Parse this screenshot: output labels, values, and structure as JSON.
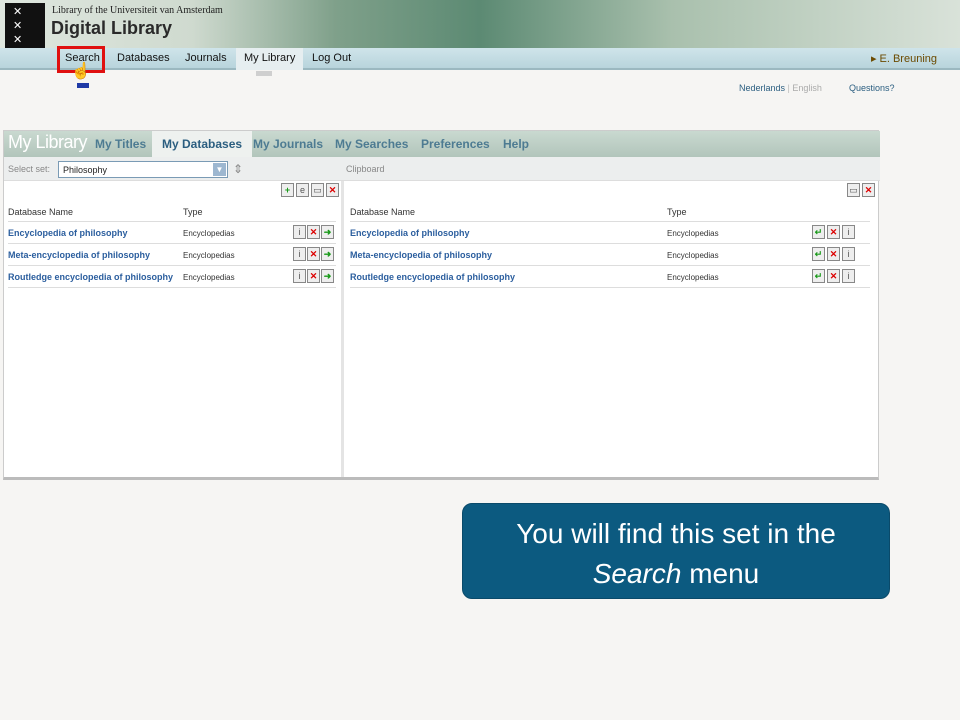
{
  "header": {
    "library_title": "Library of the Universiteit van Amsterdam",
    "brand": "Digital Library",
    "logo_glyph": "XXX",
    "nav": [
      "Search",
      "Databases",
      "Journals",
      "My Library",
      "Log Out"
    ],
    "user": "▸ E. Breuning"
  },
  "lang": {
    "nl": "Nederlands",
    "sep": "|",
    "en": "English"
  },
  "questions": "Questions?",
  "panel": {
    "title": "My Library",
    "tabs": [
      "My Titles",
      "My Databases",
      "My Journals",
      "My Searches",
      "Preferences",
      "Help"
    ],
    "select_label": "Select set:",
    "select_value": "Philosophy",
    "clipboard_label": "Clipboard",
    "columns": {
      "name": "Database Name",
      "type": "Type"
    },
    "left_rows": [
      {
        "name": "Encyclopedia of philosophy",
        "type": "Encyclopedias"
      },
      {
        "name": "Meta-encyclopedia of philosophy",
        "type": "Encyclopedias"
      },
      {
        "name": "Routledge encyclopedia of philosophy",
        "type": "Encyclopedias"
      }
    ],
    "right_rows": [
      {
        "name": "Encyclopedia of philosophy",
        "type": "Encyclopedias"
      },
      {
        "name": "Meta-encyclopedia of philosophy",
        "type": "Encyclopedias"
      },
      {
        "name": "Routledge encyclopedia of philosophy",
        "type": "Encyclopedias"
      }
    ]
  },
  "callout": {
    "line1": "You will find this set in the",
    "italic": "Search",
    "line2_rest": " menu"
  }
}
